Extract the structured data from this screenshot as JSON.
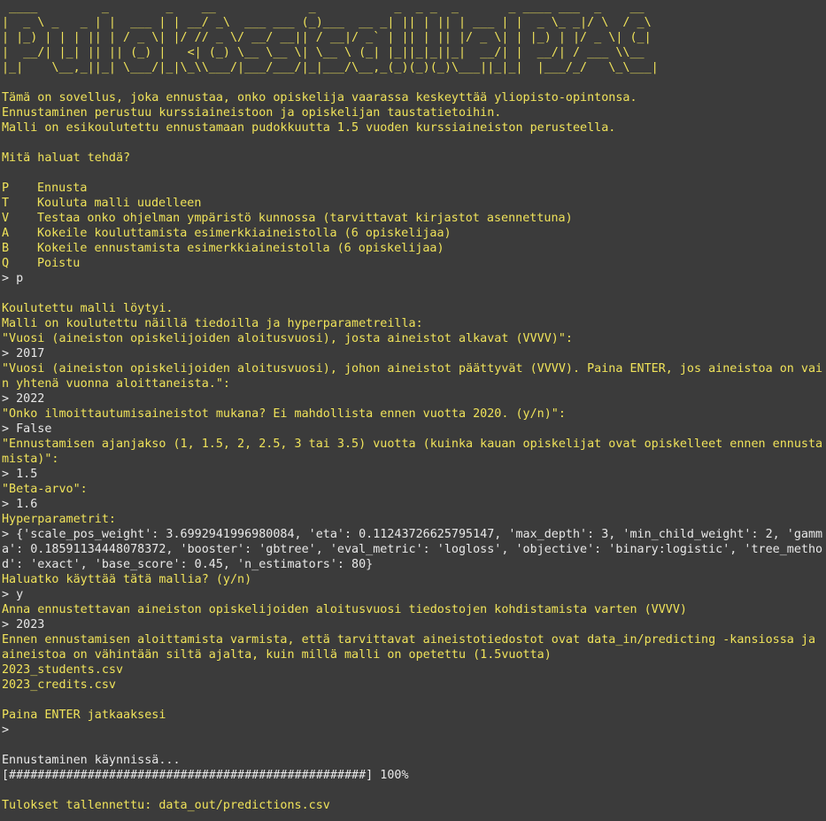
{
  "banner": [
    " ____         _        _    __             _           _  _ _  _       _ ____ ___  _    __ ",
    "|  _ \\ _   _ | |  ___ | | __/ _\\  ___ ___ (_)___  __ _| || | || | ___ | |  _ \\_ _|/ \\  / _\\",
    "| |_) | | | || | / _ \\| |/ // _ \\/ __/ __|| / __|/ _` | || | || |/ _ \\| | |_) | |/ _ \\| (_|",
    "|  __/| |_| || || (_) |   <| (_) \\__ \\__ \\| \\__ \\ (_| |_||_|_||_|  __/| |  __/| / ___ \\\\__ ",
    "|_|    \\__,_||_| \\___/|_|\\_\\\\___/|___/___/|_|___/\\__,_(_)(_)(_)\\___||_|_|  |___/_/   \\_\\___|"
  ],
  "intro": [
    "Tämä on sovellus, joka ennustaa, onko opiskelija vaarassa keskeyttää yliopisto-opintonsa.",
    "Ennustaminen perustuu kurssiaineistoon ja opiskelijan taustatietoihin.",
    "Malli on esikoulutettu ennustamaan pudokkuutta 1.5 vuoden kurssiaineiston perusteella."
  ],
  "menu_question": "Mitä haluat tehdä?",
  "menu": [
    {
      "key": "P",
      "label": "Ennusta"
    },
    {
      "key": "T",
      "label": "Kouluta malli uudelleen"
    },
    {
      "key": "V",
      "label": "Testaa onko ohjelman ympäristö kunnossa (tarvittavat kirjastot asennettuna)"
    },
    {
      "key": "A",
      "label": "Kokeile kouluttamista esimerkkiaineistolla (6 opiskelijaa)"
    },
    {
      "key": "B",
      "label": "Kokeile ennustamista esimerkkiaineistolla (6 opiskelijaa)"
    },
    {
      "key": "Q",
      "label": "Poistu"
    }
  ],
  "session": {
    "choice": "> p",
    "model_found": "Koulutettu malli löytyi.",
    "model_info": "Malli on koulutettu näillä tiedoilla ja hyperparametreilla:",
    "q_start_year": "\"Vuosi (aineiston opiskelijoiden aloitusvuosi), josta aineistot alkavat (VVVV)\":",
    "a_start_year": "> 2017",
    "q_end_year_1": "\"Vuosi (aineiston opiskelijoiden aloitusvuosi), johon aineistot päättyvät (VVVV). Paina ENTER, jos aineistoa on vai",
    "q_end_year_2": "n yhtenä vuonna aloittaneista.\":",
    "a_end_year": "> 2022",
    "q_enrollment": "\"Onko ilmoittautumisaineistot mukana? Ei mahdollista ennen vuotta 2020. (y/n)\":",
    "a_enrollment": "> False",
    "q_period_1": "\"Ennustamisen ajanjakso (1, 1.5, 2, 2.5, 3 tai 3.5) vuotta (kuinka kauan opiskelijat ovat opiskelleet ennen ennusta",
    "q_period_2": "mista)\":",
    "a_period": "> 1.5",
    "q_beta": "\"Beta-arvo\":",
    "a_beta": "> 1.6",
    "hyper_label": "Hyperparametrit:",
    "hyper_1": "> {'scale_pos_weight': 3.6992941996980084, 'eta': 0.11243726625795147, 'max_depth': 3, 'min_child_weight': 2, 'gamm",
    "hyper_2": "a': 0.18591134448078372, 'booster': 'gbtree', 'eval_metric': 'logloss', 'objective': 'binary:logistic', 'tree_metho",
    "hyper_3": "d': 'exact', 'base_score': 0.45, 'n_estimators': 80}",
    "q_use_model": "Haluatko käyttää tätä mallia? (y/n)",
    "a_use_model": "> y",
    "q_pred_year": "Anna ennustettavan aineiston opiskelijoiden aloitusvuosi tiedostojen kohdistamista varten (VVVV)",
    "a_pred_year": "> 2023",
    "notice_1": "Ennen ennustamisen aloittamista varmista, että tarvittavat aineistotiedostot ovat data_in/predicting -kansiossa ja",
    "notice_2": "aineistoa on vähintään siltä ajalta, kuin millä malli on opetettu (1.5vuotta)",
    "file_1": "2023_students.csv",
    "file_2": "2023_credits.csv",
    "press_enter": "Paina ENTER jatkaaksesi",
    "prompt_empty": ">",
    "running": "Ennustaminen käynnissä...",
    "progress_bar": "[##################################################]",
    "progress_percent": "100%",
    "progress_value": 100,
    "saved": "Tulokset tallennettu: data_out/predictions.csv"
  },
  "colors": {
    "background": "#3b3b3b",
    "text_yellow": "#f0e35a",
    "text_white": "#e8e8e8"
  }
}
